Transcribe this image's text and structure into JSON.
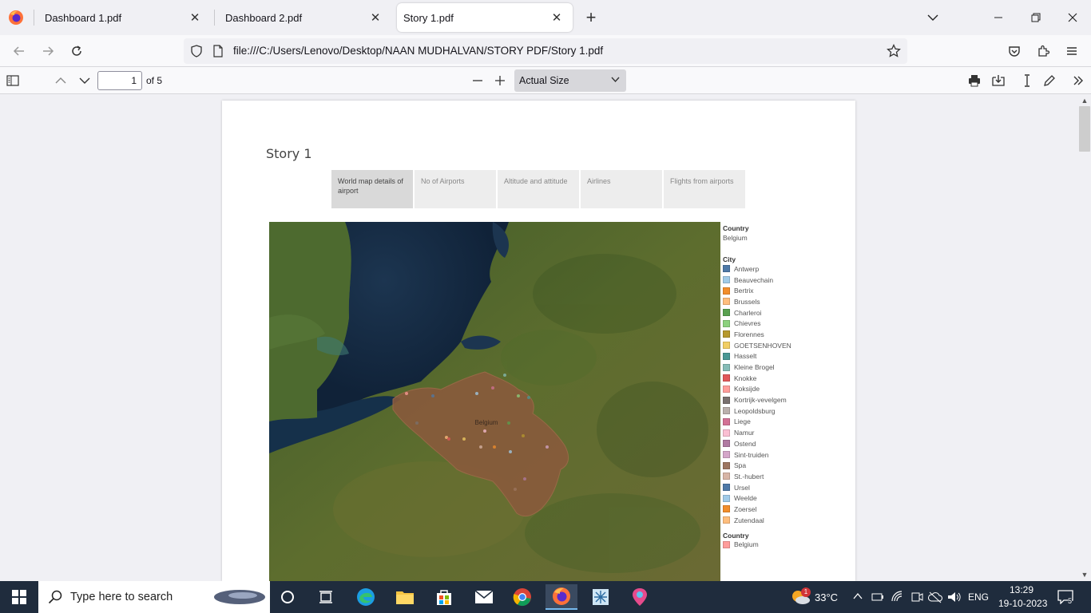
{
  "browser": {
    "tabs": [
      {
        "title": "Dashboard 1.pdf",
        "active": false
      },
      {
        "title": "Dashboard 2.pdf",
        "active": false
      },
      {
        "title": "Story 1.pdf",
        "active": true
      }
    ],
    "url": "file:///C:/Users/Lenovo/Desktop/NAAN MUDHALVAN/STORY PDF/Story 1.pdf"
  },
  "pdf_toolbar": {
    "page_number": "1",
    "page_count_label": "of 5",
    "zoom_label": "Actual Size"
  },
  "document": {
    "title": "Story 1",
    "story_tabs": [
      {
        "label": "World map details of airport",
        "selected": true
      },
      {
        "label": "No of Airports",
        "selected": false
      },
      {
        "label": "Altitude and attitude",
        "selected": false
      },
      {
        "label": "Airlines",
        "selected": false
      },
      {
        "label": "Flights from airports",
        "selected": false
      }
    ],
    "map_label": "Belgium",
    "legend": {
      "country_heading": "Country",
      "country_value": "Belgium",
      "city_heading": "City",
      "cities": [
        {
          "name": "Antwerp",
          "color": "#4e79a7"
        },
        {
          "name": "Beauvechain",
          "color": "#a0cbe8"
        },
        {
          "name": "Bertrix",
          "color": "#f28e2b"
        },
        {
          "name": "Brussels",
          "color": "#ffbe7d"
        },
        {
          "name": "Charleroi",
          "color": "#59a14f"
        },
        {
          "name": "Chievres",
          "color": "#8cd17d"
        },
        {
          "name": "Florennes",
          "color": "#b6992d"
        },
        {
          "name": "GOETSENHOVEN",
          "color": "#f1ce63"
        },
        {
          "name": "Hasselt",
          "color": "#499894"
        },
        {
          "name": "Kleine Brogel",
          "color": "#86bcb6"
        },
        {
          "name": "Knokke",
          "color": "#e15759"
        },
        {
          "name": "Koksijde",
          "color": "#ff9d9a"
        },
        {
          "name": "Kortrijk-vevelgem",
          "color": "#79706e"
        },
        {
          "name": "Leopoldsburg",
          "color": "#bab0ac"
        },
        {
          "name": "Liege",
          "color": "#d37295"
        },
        {
          "name": "Namur",
          "color": "#fabfd2"
        },
        {
          "name": "Ostend",
          "color": "#b07aa1"
        },
        {
          "name": "Sint-truiden",
          "color": "#d4a6c8"
        },
        {
          "name": "Spa",
          "color": "#9d7660"
        },
        {
          "name": "St.-hubert",
          "color": "#d7b5a6"
        },
        {
          "name": "Ursel",
          "color": "#4e79a7"
        },
        {
          "name": "Weelde",
          "color": "#a0cbe8"
        },
        {
          "name": "Zoersel",
          "color": "#f28e2b"
        },
        {
          "name": "Zutendaal",
          "color": "#ffbe7d"
        }
      ],
      "country_heading_2": "Country",
      "country_items": [
        {
          "name": "Belgium",
          "color": "#ff9d9a"
        }
      ]
    }
  },
  "taskbar": {
    "search_placeholder": "Type here to search",
    "weather": "33°C",
    "weather_badge": "1",
    "language": "ENG",
    "time": "13:29",
    "date": "19-10-2023",
    "notifications": "5"
  }
}
